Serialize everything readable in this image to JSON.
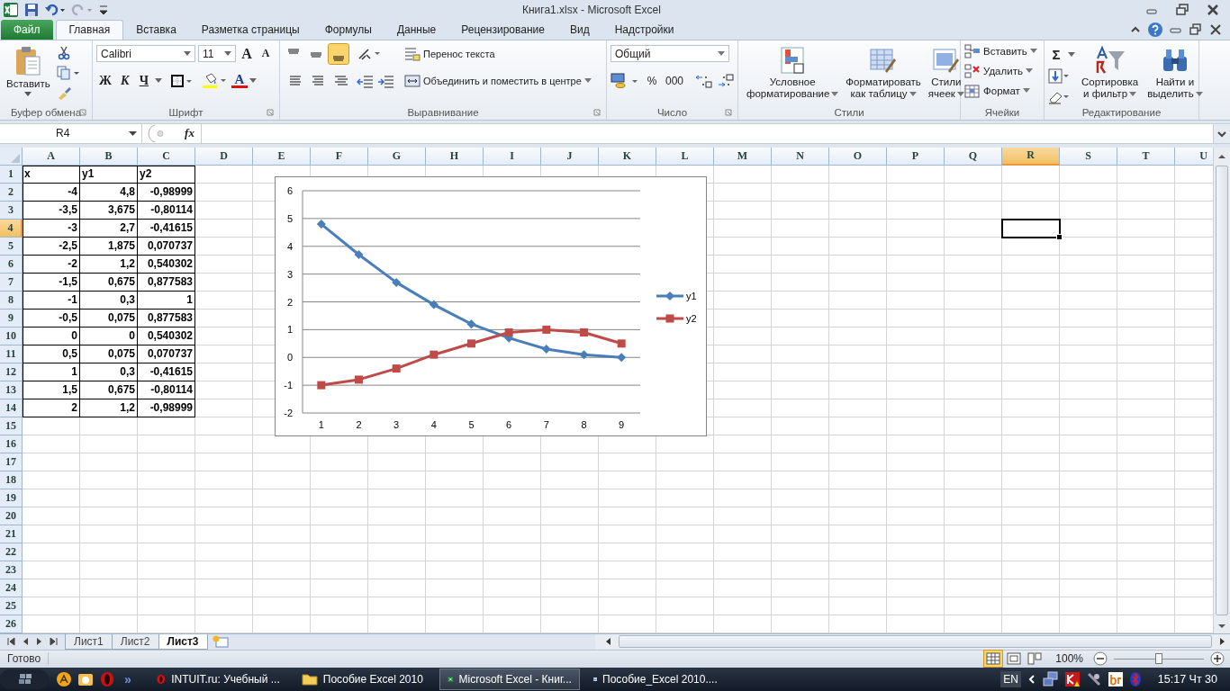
{
  "window": {
    "title": "Книга1.xlsx  -  Microsoft Excel"
  },
  "ribbon_tabs": [
    {
      "label": "Файл",
      "kind": "file",
      "selected": false
    },
    {
      "label": "Главная",
      "kind": "tab",
      "selected": true
    },
    {
      "label": "Вставка",
      "kind": "tab",
      "selected": false
    },
    {
      "label": "Разметка страницы",
      "kind": "tab",
      "selected": false
    },
    {
      "label": "Формулы",
      "kind": "tab",
      "selected": false
    },
    {
      "label": "Данные",
      "kind": "tab",
      "selected": false
    },
    {
      "label": "Рецензирование",
      "kind": "tab",
      "selected": false
    },
    {
      "label": "Вид",
      "kind": "tab",
      "selected": false
    },
    {
      "label": "Надстройки",
      "kind": "tab",
      "selected": false
    }
  ],
  "ribbon": {
    "clipboard": {
      "label": "Буфер обмена",
      "paste": "Вставить"
    },
    "font": {
      "label": "Шрифт",
      "family": "Calibri",
      "size": "11",
      "grow": "A",
      "shrink": "A",
      "bold": "Ж",
      "italic": "К",
      "underline": "Ч",
      "font_color": "A"
    },
    "alignment": {
      "label": "Выравнивание",
      "vertical": [
        {
          "kind": "top",
          "selected": false
        },
        {
          "kind": "middle",
          "selected": false
        },
        {
          "kind": "bottom",
          "selected": true
        }
      ],
      "horizontal": [
        {
          "kind": "left",
          "selected": false
        },
        {
          "kind": "center",
          "selected": false
        },
        {
          "kind": "right",
          "selected": false
        }
      ],
      "wrap_text": "Перенос текста",
      "merge": "Объединить и поместить в центре"
    },
    "number": {
      "label": "Число",
      "format": "Общий",
      "percent": "%",
      "thousands": "000"
    },
    "styles": {
      "label": "Стили",
      "buttons": [
        {
          "lines": [
            "Условное",
            "форматирование"
          ]
        },
        {
          "lines": [
            "Форматировать",
            "как таблицу"
          ]
        },
        {
          "lines": [
            "Стили",
            "ячеек"
          ]
        }
      ]
    },
    "cells": {
      "label": "Ячейки",
      "buttons": [
        "Вставить",
        "Удалить",
        "Формат"
      ]
    },
    "editing": {
      "label": "Редактирование",
      "sum": "Σ",
      "buttons": [
        {
          "lines": [
            "Сортировка",
            "и фильтр"
          ]
        },
        {
          "lines": [
            "Найти и",
            "выделить"
          ]
        }
      ]
    }
  },
  "formula_bar": {
    "name_box": "R4",
    "function_button": "fx"
  },
  "sheet": {
    "columns": [
      {
        "label": "A",
        "selected": false
      },
      {
        "label": "B",
        "selected": false
      },
      {
        "label": "C",
        "selected": false
      },
      {
        "label": "D",
        "selected": false
      },
      {
        "label": "E",
        "selected": false
      },
      {
        "label": "F",
        "selected": false
      },
      {
        "label": "G",
        "selected": false
      },
      {
        "label": "H",
        "selected": false
      },
      {
        "label": "I",
        "selected": false
      },
      {
        "label": "J",
        "selected": false
      },
      {
        "label": "K",
        "selected": false
      },
      {
        "label": "L",
        "selected": false
      },
      {
        "label": "M",
        "selected": false
      },
      {
        "label": "N",
        "selected": false
      },
      {
        "label": "O",
        "selected": false
      },
      {
        "label": "P",
        "selected": false
      },
      {
        "label": "Q",
        "selected": false
      },
      {
        "label": "R",
        "selected": true
      },
      {
        "label": "S",
        "selected": false
      },
      {
        "label": "T",
        "selected": false
      },
      {
        "label": "U",
        "selected": false
      }
    ],
    "rows": [
      {
        "number": "1",
        "selected": false,
        "kind": "header",
        "cells": [
          "x",
          "y1",
          "y2"
        ]
      },
      {
        "number": "2",
        "selected": false,
        "cells": [
          "-4",
          "4,8",
          "-0,98999"
        ]
      },
      {
        "number": "3",
        "selected": false,
        "cells": [
          "-3,5",
          "3,675",
          "-0,80114"
        ]
      },
      {
        "number": "4",
        "selected": true,
        "cells": [
          "-3",
          "2,7",
          "-0,41615"
        ]
      },
      {
        "number": "5",
        "selected": false,
        "cells": [
          "-2,5",
          "1,875",
          "0,070737"
        ]
      },
      {
        "number": "6",
        "selected": false,
        "cells": [
          "-2",
          "1,2",
          "0,540302"
        ]
      },
      {
        "number": "7",
        "selected": false,
        "cells": [
          "-1,5",
          "0,675",
          "0,877583"
        ]
      },
      {
        "number": "8",
        "selected": false,
        "cells": [
          "-1",
          "0,3",
          "1"
        ]
      },
      {
        "number": "9",
        "selected": false,
        "cells": [
          "-0,5",
          "0,075",
          "0,877583"
        ]
      },
      {
        "number": "10",
        "selected": false,
        "cells": [
          "0",
          "0",
          "0,540302"
        ]
      },
      {
        "number": "11",
        "selected": false,
        "cells": [
          "0,5",
          "0,075",
          "0,070737"
        ]
      },
      {
        "number": "12",
        "selected": false,
        "cells": [
          "1",
          "0,3",
          "-0,41615"
        ]
      },
      {
        "number": "13",
        "selected": false,
        "cells": [
          "1,5",
          "0,675",
          "-0,80114"
        ]
      },
      {
        "number": "14",
        "selected": false,
        "cells": [
          "2",
          "1,2",
          "-0,98999"
        ]
      },
      {
        "number": "15",
        "selected": false
      },
      {
        "number": "16",
        "selected": false
      },
      {
        "number": "17",
        "selected": false
      },
      {
        "number": "18",
        "selected": false
      },
      {
        "number": "19",
        "selected": false
      },
      {
        "number": "20",
        "selected": false
      },
      {
        "number": "21",
        "selected": false
      },
      {
        "number": "22",
        "selected": false
      },
      {
        "number": "23",
        "selected": false
      },
      {
        "number": "24",
        "selected": false
      },
      {
        "number": "25",
        "selected": false
      },
      {
        "number": "26",
        "selected": false
      }
    ]
  },
  "chart": {
    "chart_data": {
      "type": "line",
      "categories": [
        "1",
        "2",
        "3",
        "4",
        "5",
        "6",
        "7",
        "8",
        "9"
      ],
      "series": [
        {
          "name": "y1",
          "color": "#4a7ebb",
          "marker": "diamond",
          "values": [
            4.8,
            3.7,
            2.7,
            1.9,
            1.2,
            0.7,
            0.3,
            0.1,
            0
          ]
        },
        {
          "name": "y2",
          "color": "#be4b48",
          "marker": "square",
          "values": [
            -1,
            -0.8,
            -0.4,
            0.1,
            0.5,
            0.9,
            1,
            0.9,
            0.5
          ]
        }
      ],
      "ylim": [
        -2,
        6
      ],
      "yticks": [
        -2,
        -1,
        0,
        1,
        2,
        3,
        4,
        5,
        6
      ],
      "grid": true,
      "legend": "right"
    }
  },
  "sheet_tabs": [
    {
      "label": "Лист1",
      "selected": false
    },
    {
      "label": "Лист2",
      "selected": false
    },
    {
      "label": "Лист3",
      "selected": true
    }
  ],
  "status_bar": {
    "status": "Готово",
    "views": [
      {
        "kind": "normal",
        "selected": true
      },
      {
        "kind": "layout",
        "selected": false
      },
      {
        "kind": "pagebreak",
        "selected": false
      }
    ],
    "zoom": "100%",
    "zoom_slider": {
      "level": 0.5
    }
  },
  "taskbar": {
    "more": "»",
    "items": [
      {
        "label": "INTUIT.ru: Учебный ...",
        "kind": "opera",
        "selected": false
      },
      {
        "label": "Пособие Excel 2010",
        "kind": "folder",
        "selected": false
      },
      {
        "label": "Microsoft Excel - Книг...",
        "kind": "excel",
        "selected": true
      },
      {
        "label": "Пособие_Excel 2010....",
        "kind": "word",
        "selected": false
      }
    ],
    "language": "EN",
    "clock": "15:17 Чт 30"
  }
}
